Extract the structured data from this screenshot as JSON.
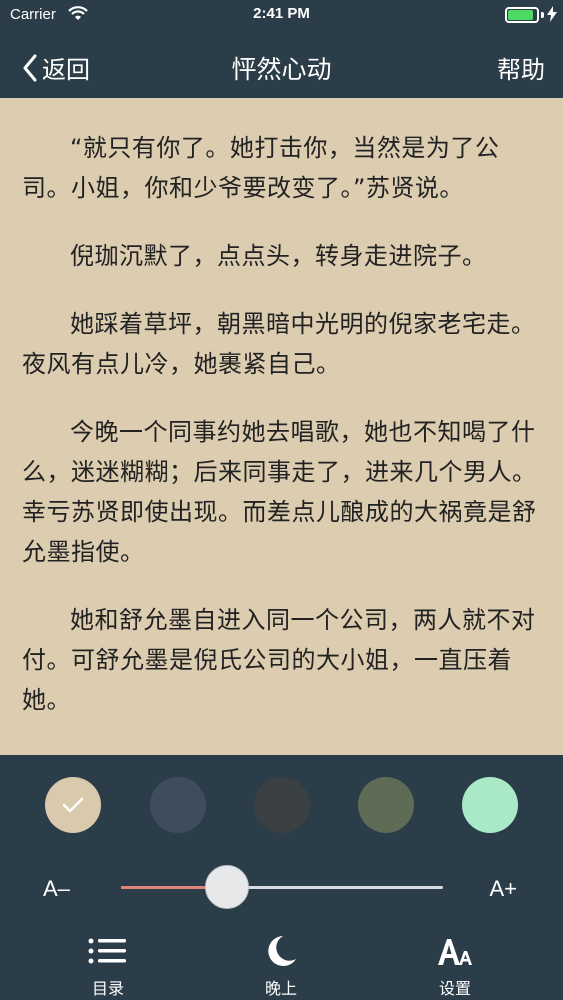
{
  "status_bar": {
    "carrier": "Carrier",
    "time": "2:41 PM",
    "battery_level": 0.9
  },
  "nav": {
    "back_label": "返回",
    "title": "怦然心动",
    "help_label": "帮助"
  },
  "content": {
    "paragraphs": [
      "“就只有你了。她打击你，当然是为了公司。小姐，你和少爷要改变了。”苏贤说。",
      "倪珈沉默了，点点头，转身走进院子。",
      "她踩着草坪，朝黑暗中光明的倪家老宅走。夜风有点儿冷，她裹紧自己。",
      "今晚一个同事约她去唱歌，她也不知喝了什么，迷迷糊糊；后来同事走了，进来几个男人。幸亏苏贤即使出现。而差点儿酿成的大祸竟是舒允墨指使。",
      "她和舒允墨自进入同一个公司，两人就不对付。可舒允墨是倪氏公司的大小姐，一直压着她。"
    ]
  },
  "theme_swatches": [
    {
      "color": "#d9c9ad",
      "selected": true
    },
    {
      "color": "#3e4c5e",
      "selected": false
    },
    {
      "color": "#3b4043",
      "selected": false
    },
    {
      "color": "#5e6c56",
      "selected": false
    },
    {
      "color": "#a9e9c7",
      "selected": false
    }
  ],
  "font_size": {
    "decrease_label": "A–",
    "increase_label": "A+",
    "level": 0.33
  },
  "tabs": [
    {
      "label": "目录",
      "icon": "list-icon"
    },
    {
      "label": "晚上",
      "icon": "moon-icon"
    },
    {
      "label": "设置",
      "icon": "font-settings-icon"
    }
  ]
}
